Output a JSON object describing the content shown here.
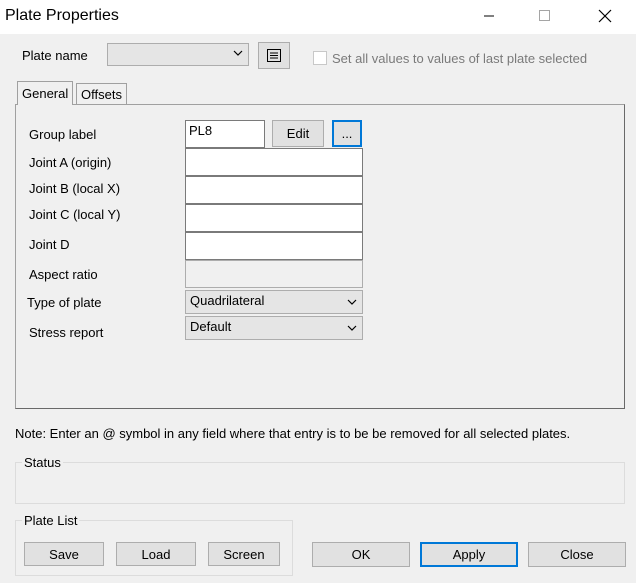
{
  "window": {
    "title": "Plate Properties",
    "minimize_icon": "minimize-icon",
    "maximize_icon": "maximize-icon",
    "close_icon": "close-icon"
  },
  "header": {
    "plate_name_label": "Plate name",
    "plate_name_value": "",
    "list_icon": "list-icon",
    "set_all_label": "Set all values to values of last plate selected"
  },
  "tabs": [
    {
      "label": "General",
      "active": true
    },
    {
      "label": "Offsets",
      "active": false
    }
  ],
  "general": {
    "group_label": {
      "label": "Group label",
      "value": "PL8"
    },
    "edit_button": "Edit",
    "browse_button": "...",
    "joint_a": {
      "label": "Joint A (origin)",
      "value": ""
    },
    "joint_b": {
      "label": "Joint B (local X)",
      "value": ""
    },
    "joint_c": {
      "label": "Joint C (local Y)",
      "value": ""
    },
    "joint_d": {
      "label": "Joint D",
      "value": ""
    },
    "aspect_ratio": {
      "label": "Aspect ratio",
      "value": ""
    },
    "plate_type": {
      "label": "Type of plate",
      "value": "Quadrilateral"
    },
    "stress_report": {
      "label": "Stress report",
      "value": "Default"
    }
  },
  "note": "Note:  Enter an @ symbol in any field where that entry is to be be removed for all selected plates.",
  "status": {
    "label": "Status",
    "text": ""
  },
  "plate_list": {
    "label": "Plate List",
    "save": "Save",
    "load": "Load",
    "screen": "Screen"
  },
  "actions": {
    "ok": "OK",
    "apply": "Apply",
    "close": "Close"
  },
  "colors": {
    "focus_accent": "#0078d7"
  }
}
